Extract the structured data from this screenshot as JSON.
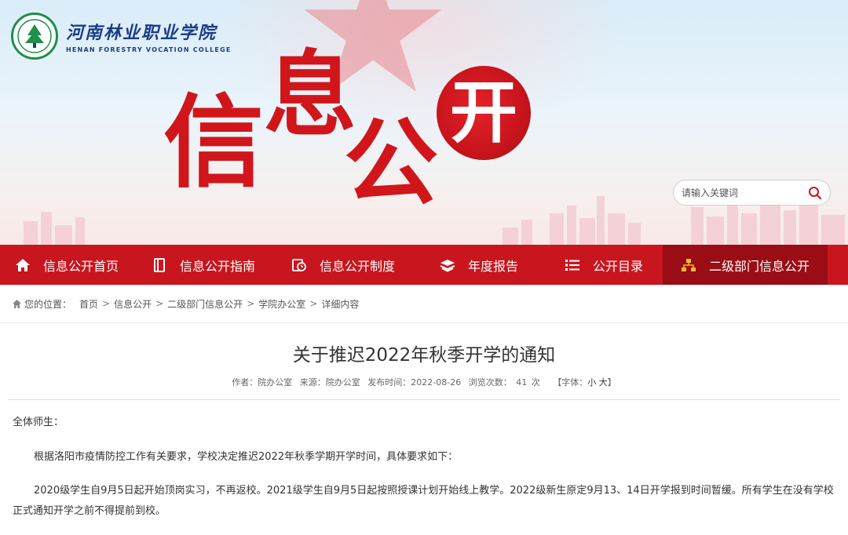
{
  "site": {
    "name_cn": "河南林业职业学院",
    "name_en": "HENAN FORESTRY VOCATION COLLEGE",
    "banner_chars": [
      "信",
      "息",
      "公",
      "开"
    ]
  },
  "search": {
    "placeholder": "请输入关键词"
  },
  "nav": {
    "items": [
      {
        "label": "信息公开首页",
        "icon": "home-icon"
      },
      {
        "label": "信息公开指南",
        "icon": "book-icon"
      },
      {
        "label": "信息公开制度",
        "icon": "clock-doc-icon"
      },
      {
        "label": "年度报告",
        "icon": "layers-icon"
      },
      {
        "label": "公开目录",
        "icon": "list-icon"
      },
      {
        "label": "二级部门信息公开",
        "icon": "org-chart-icon"
      }
    ],
    "active_index": 5
  },
  "breadcrumb": {
    "prefix": "您的位置：",
    "items": [
      "首页",
      "信息公开",
      "二级部门信息公开",
      "学院办公室",
      "详细内容"
    ],
    "separator": ">"
  },
  "article": {
    "title": "关于推迟2022年秋季开学的通知",
    "meta": {
      "author": "作者：院办公室",
      "source": "来源：院办公室",
      "published": "发布时间：2022-08-26",
      "views_label": "浏览次数：",
      "views": "41",
      "views_unit": "次",
      "font_label": "【字体：",
      "font_small": "小",
      "font_large": "大",
      "font_close": "】"
    },
    "greeting": "全体师生：",
    "paragraphs": [
      "根据洛阳市疫情防控工作有关要求，学校决定推迟2022年秋季学期开学时间，具体要求如下：",
      "2020级学生自9月5日起开始顶岗实习，不再返校。2021级学生自9月5日起按照授课计划开始线上教学。2022级新生原定9月13、14日开学报到时间暂缓。所有学生在没有学校正式通知开学之前不得提前到校。"
    ]
  },
  "colors": {
    "primary_red": "#c9151e",
    "active_red": "#9a0d14",
    "logo_blue": "#1a3d86",
    "logo_green": "#1f8f4a"
  }
}
